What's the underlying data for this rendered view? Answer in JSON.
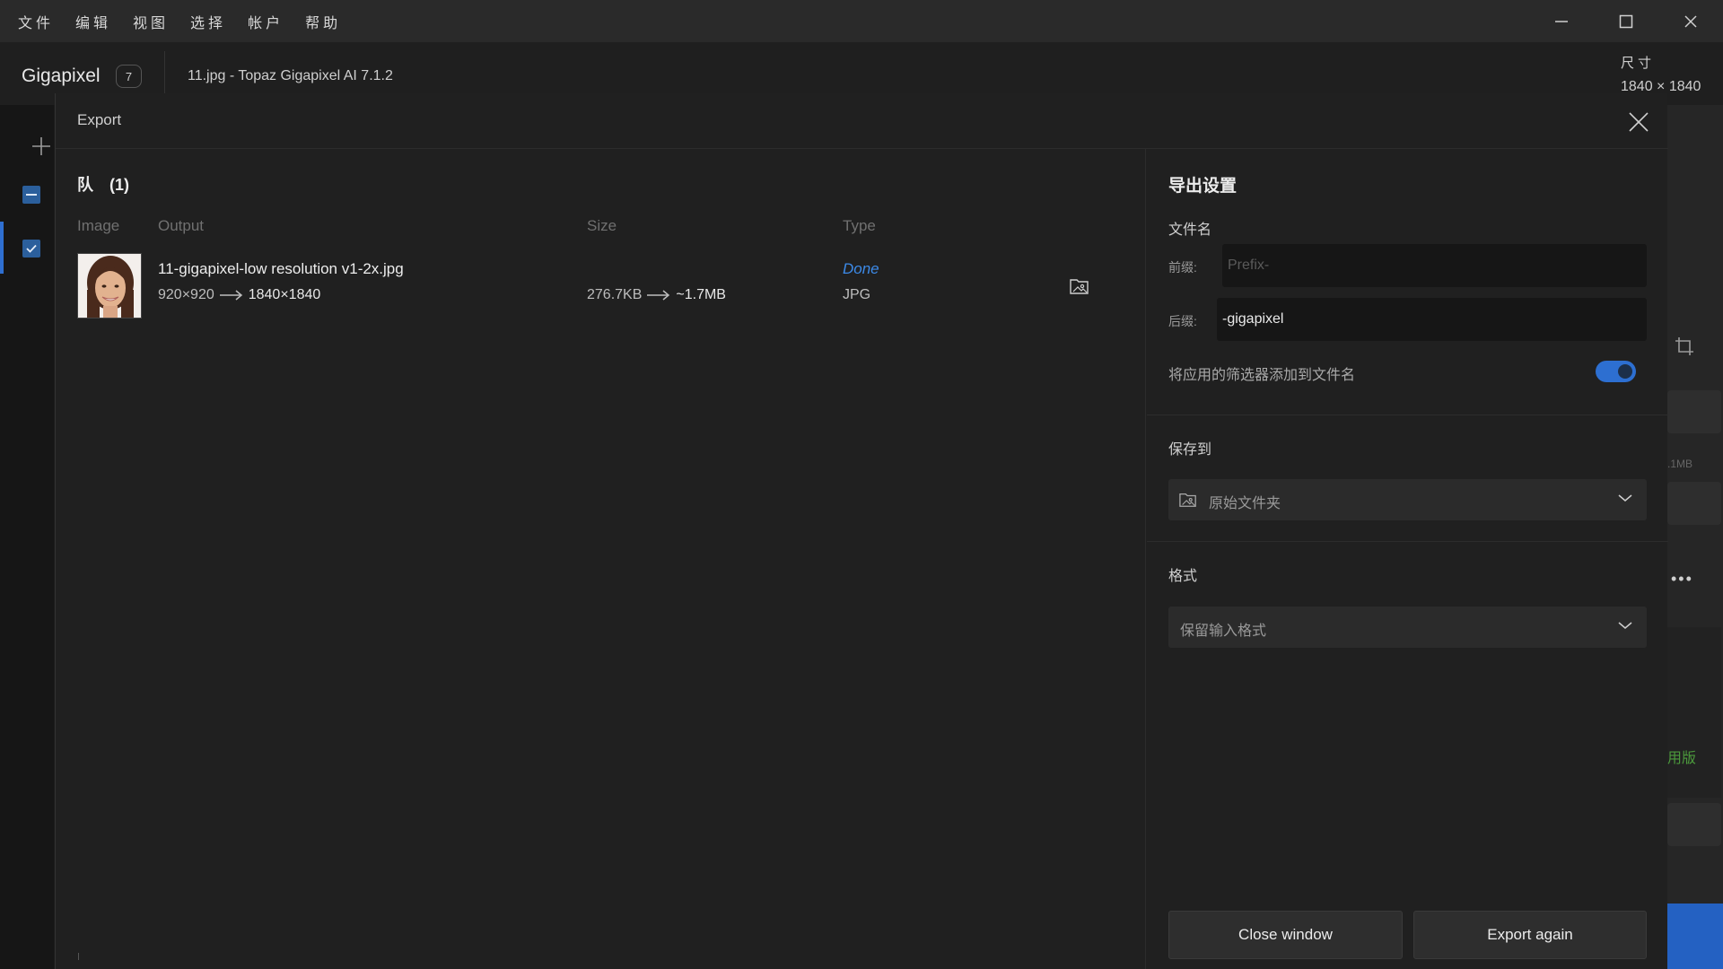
{
  "menu": {
    "items": [
      "文件",
      "编辑",
      "视图",
      "选择",
      "帐户",
      "帮助"
    ]
  },
  "header": {
    "app_name": "Gigapixel",
    "badge_count": "7",
    "document_title": "11.jpg - Topaz Gigapixel AI 7.1.2",
    "dimension_label": "尺寸",
    "dimension_value": "1840 × 1840"
  },
  "background": {
    "size_fragment": ".1MB",
    "green_text": "用版"
  },
  "modal": {
    "title": "Export",
    "queue": {
      "title": "队　(1)",
      "columns": {
        "image": "Image",
        "output": "Output",
        "size": "Size",
        "type": "Type"
      },
      "rows": [
        {
          "output_name": "11-gigapixel-low resolution v1-2x.jpg",
          "dims_from": "920×920",
          "dims_to": "1840×1840",
          "size_from": "276.7KB",
          "size_to": "~1.7MB",
          "status": "Done",
          "type": "JPG"
        }
      ]
    },
    "settings": {
      "title": "导出设置",
      "filename_label": "文件名",
      "prefix_label": "前缀:",
      "prefix_placeholder": "Prefix-",
      "prefix_value": "",
      "suffix_label": "后缀:",
      "suffix_value": "-gigapixel",
      "append_filters_label": "将应用的筛选器添加到文件名",
      "append_filters_on": true,
      "save_to_label": "保存到",
      "save_to_value": "原始文件夹",
      "format_label": "格式",
      "format_value": "保留输入格式",
      "close_button": "Close window",
      "export_button": "Export again"
    }
  },
  "colors": {
    "accent": "#2d6fd1",
    "done": "#3c8ae8",
    "panel": "#202020",
    "field": "#161616"
  },
  "icons": [
    "plus-icon",
    "minimize-icon",
    "maximize-icon",
    "close-icon",
    "checkbox-icon",
    "folder-image-icon",
    "chevron-down-icon",
    "arrow-right-icon",
    "crop-icon",
    "more-icon"
  ]
}
